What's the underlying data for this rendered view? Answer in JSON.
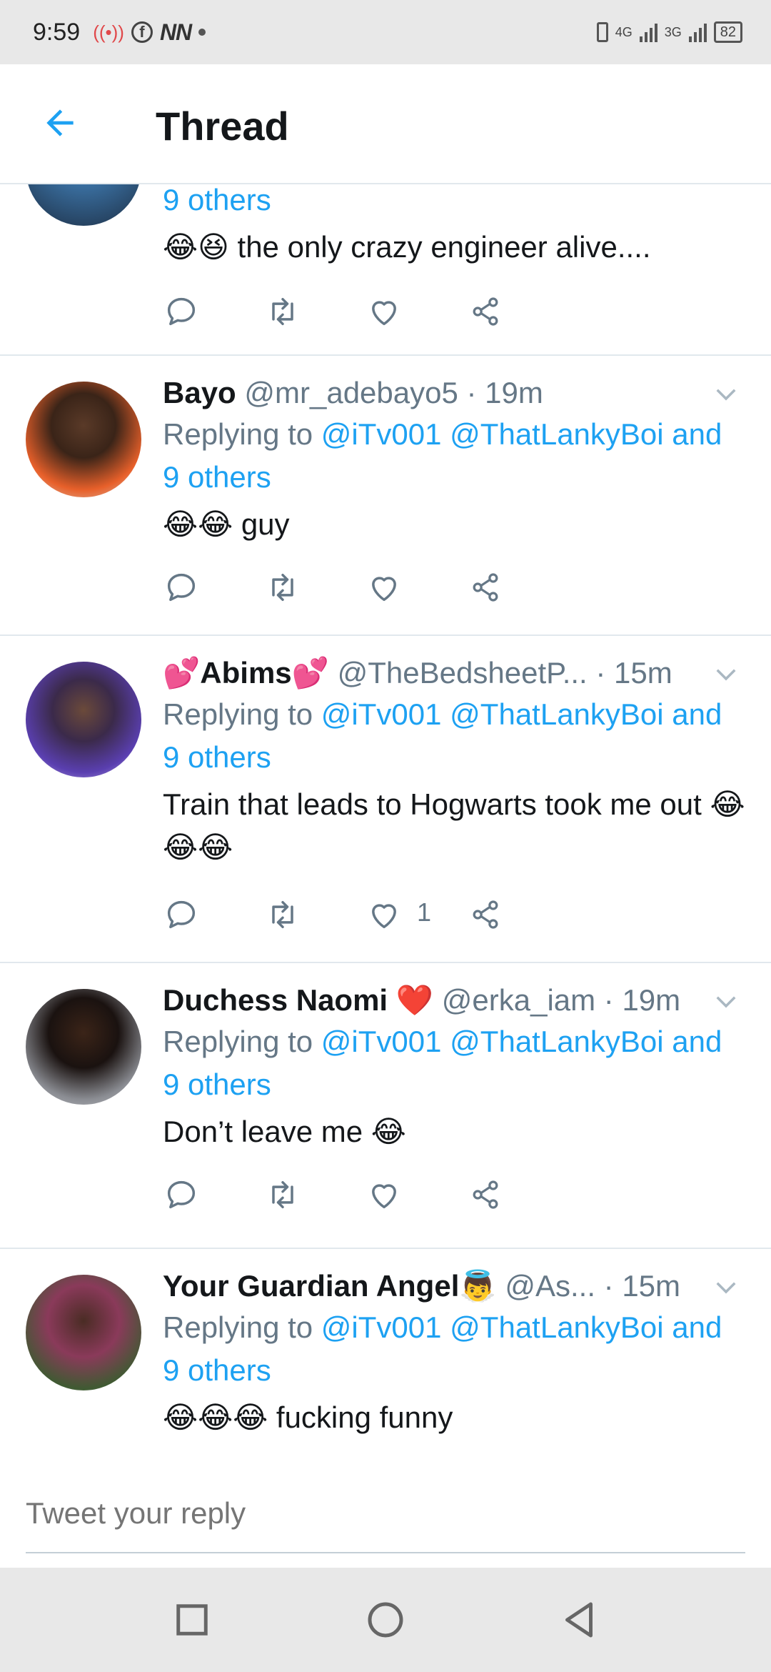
{
  "status_bar": {
    "time": "9:59",
    "nn": "NN",
    "net_4g": "4G",
    "net_3g": "3G",
    "battery": "82"
  },
  "header": {
    "title": "Thread"
  },
  "colors": {
    "accent": "#1da1f2",
    "muted": "#657786",
    "text": "#14171a"
  },
  "tweets": [
    {
      "others": "9 others",
      "text": "😂😆 the only crazy engineer alive...."
    },
    {
      "name": "Bayo",
      "handle": "@mr_adebayo5 · 19m",
      "replying_prefix": "Replying to ",
      "replying_links": "@iTv001 @ThatLankyBoi and",
      "others": "9 others",
      "text": "😂😂 guy"
    },
    {
      "name": "💕Abims💕",
      "handle": "@TheBedsheetP... · 15m",
      "replying_prefix": "Replying to ",
      "replying_links": "@iTv001 @ThatLankyBoi and",
      "others": "9 others",
      "text": "Train that leads to Hogwarts took me out 😂😂😂",
      "like_count": "1"
    },
    {
      "name": "Duchess Naomi ❤️",
      "handle": "@erka_iam · 19m",
      "replying_prefix": "Replying to ",
      "replying_links": "@iTv001 @ThatLankyBoi and",
      "others": "9 others",
      "text": "Don’t leave me 😂"
    },
    {
      "name": "Your Guardian Angel👼",
      "handle": "@As... · 15m",
      "replying_prefix": "Replying to ",
      "replying_links": "@iTv001 @ThatLankyBoi and",
      "others": "9 others",
      "text": "😂😂😂 fucking funny"
    }
  ],
  "reply_bar": {
    "placeholder": "Tweet your reply"
  }
}
